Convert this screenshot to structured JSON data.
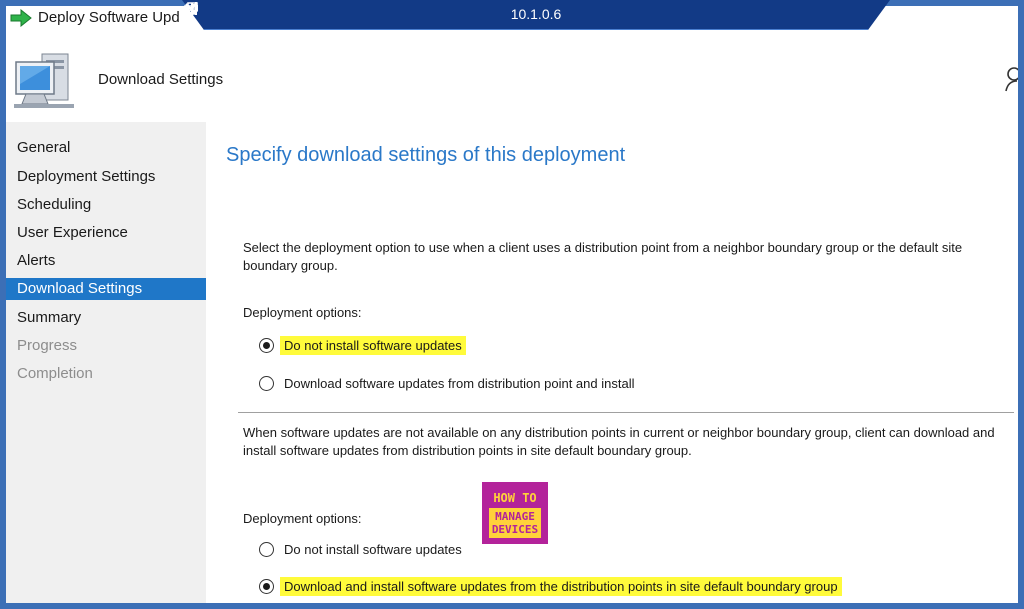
{
  "window": {
    "title": "Deploy Software Upd"
  },
  "rdp": {
    "ip": "10.1.0.6"
  },
  "header": {
    "title": "Download Settings"
  },
  "sidebar": {
    "items": [
      {
        "label": "General",
        "state": "normal"
      },
      {
        "label": "Deployment Settings",
        "state": "normal"
      },
      {
        "label": "Scheduling",
        "state": "normal"
      },
      {
        "label": "User Experience",
        "state": "normal"
      },
      {
        "label": "Alerts",
        "state": "normal"
      },
      {
        "label": "Download Settings",
        "state": "selected"
      },
      {
        "label": "Summary",
        "state": "normal"
      },
      {
        "label": "Progress",
        "state": "disabled"
      },
      {
        "label": "Completion",
        "state": "disabled"
      }
    ]
  },
  "main": {
    "title": "Specify download settings of this deployment",
    "section1": {
      "description": "Select the deployment option to use when a client uses a distribution point from a neighbor boundary group or the default site boundary group.",
      "options_label": "Deployment options:",
      "options": [
        {
          "label": "Do not install software updates",
          "checked": true,
          "highlighted": true
        },
        {
          "label": "Download software updates from distribution point and install",
          "checked": false,
          "highlighted": false
        }
      ]
    },
    "section2": {
      "description": "When software updates are not available on any distribution points in current or neighbor boundary group, client can download and install software updates from distribution points in site default boundary group.",
      "options_label": "Deployment options:",
      "options": [
        {
          "label": "Do not install software updates",
          "checked": false,
          "highlighted": false
        },
        {
          "label": "Download and install software updates from the distribution points in site default boundary group",
          "checked": true,
          "highlighted": true
        }
      ]
    },
    "logo": {
      "line1": "HOW TO",
      "line2": "MANAGE",
      "line3": "DEVICES"
    }
  },
  "colors": {
    "accent": "#1f77c8",
    "title_blue": "#2a78c8",
    "highlight": "#fffb3b",
    "rdp_bar": "#123a86"
  }
}
